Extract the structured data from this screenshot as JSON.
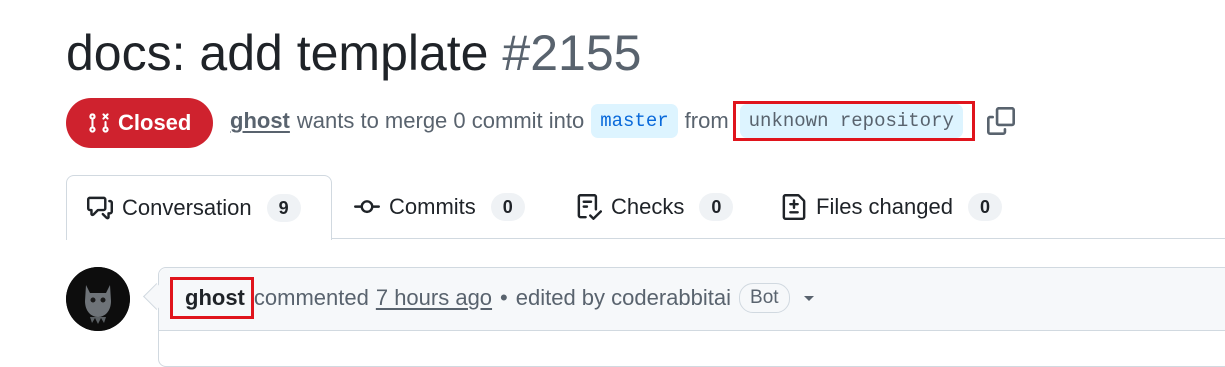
{
  "pr": {
    "title": "docs: add template",
    "number": "#2155",
    "state": "Closed",
    "author": "ghost",
    "merge_text": "wants to merge 0 commit into",
    "base_branch": "master",
    "from_text": "from",
    "head_branch": "unknown repository"
  },
  "tabs": [
    {
      "label": "Conversation",
      "count": "9",
      "icon": "comment-discussion-icon"
    },
    {
      "label": "Commits",
      "count": "0",
      "icon": "git-commit-icon"
    },
    {
      "label": "Checks",
      "count": "0",
      "icon": "checklist-icon"
    },
    {
      "label": "Files changed",
      "count": "0",
      "icon": "file-diff-icon"
    }
  ],
  "comment": {
    "author": "ghost",
    "action": "commented",
    "time": "7 hours ago",
    "separator": "•",
    "edited_by": "edited by coderabbitai",
    "badge": "Bot"
  },
  "colors": {
    "closed": "#cf222e",
    "branch_bg": "#ddf4ff",
    "branch_text": "#0969da",
    "highlight": "#e0141c"
  }
}
